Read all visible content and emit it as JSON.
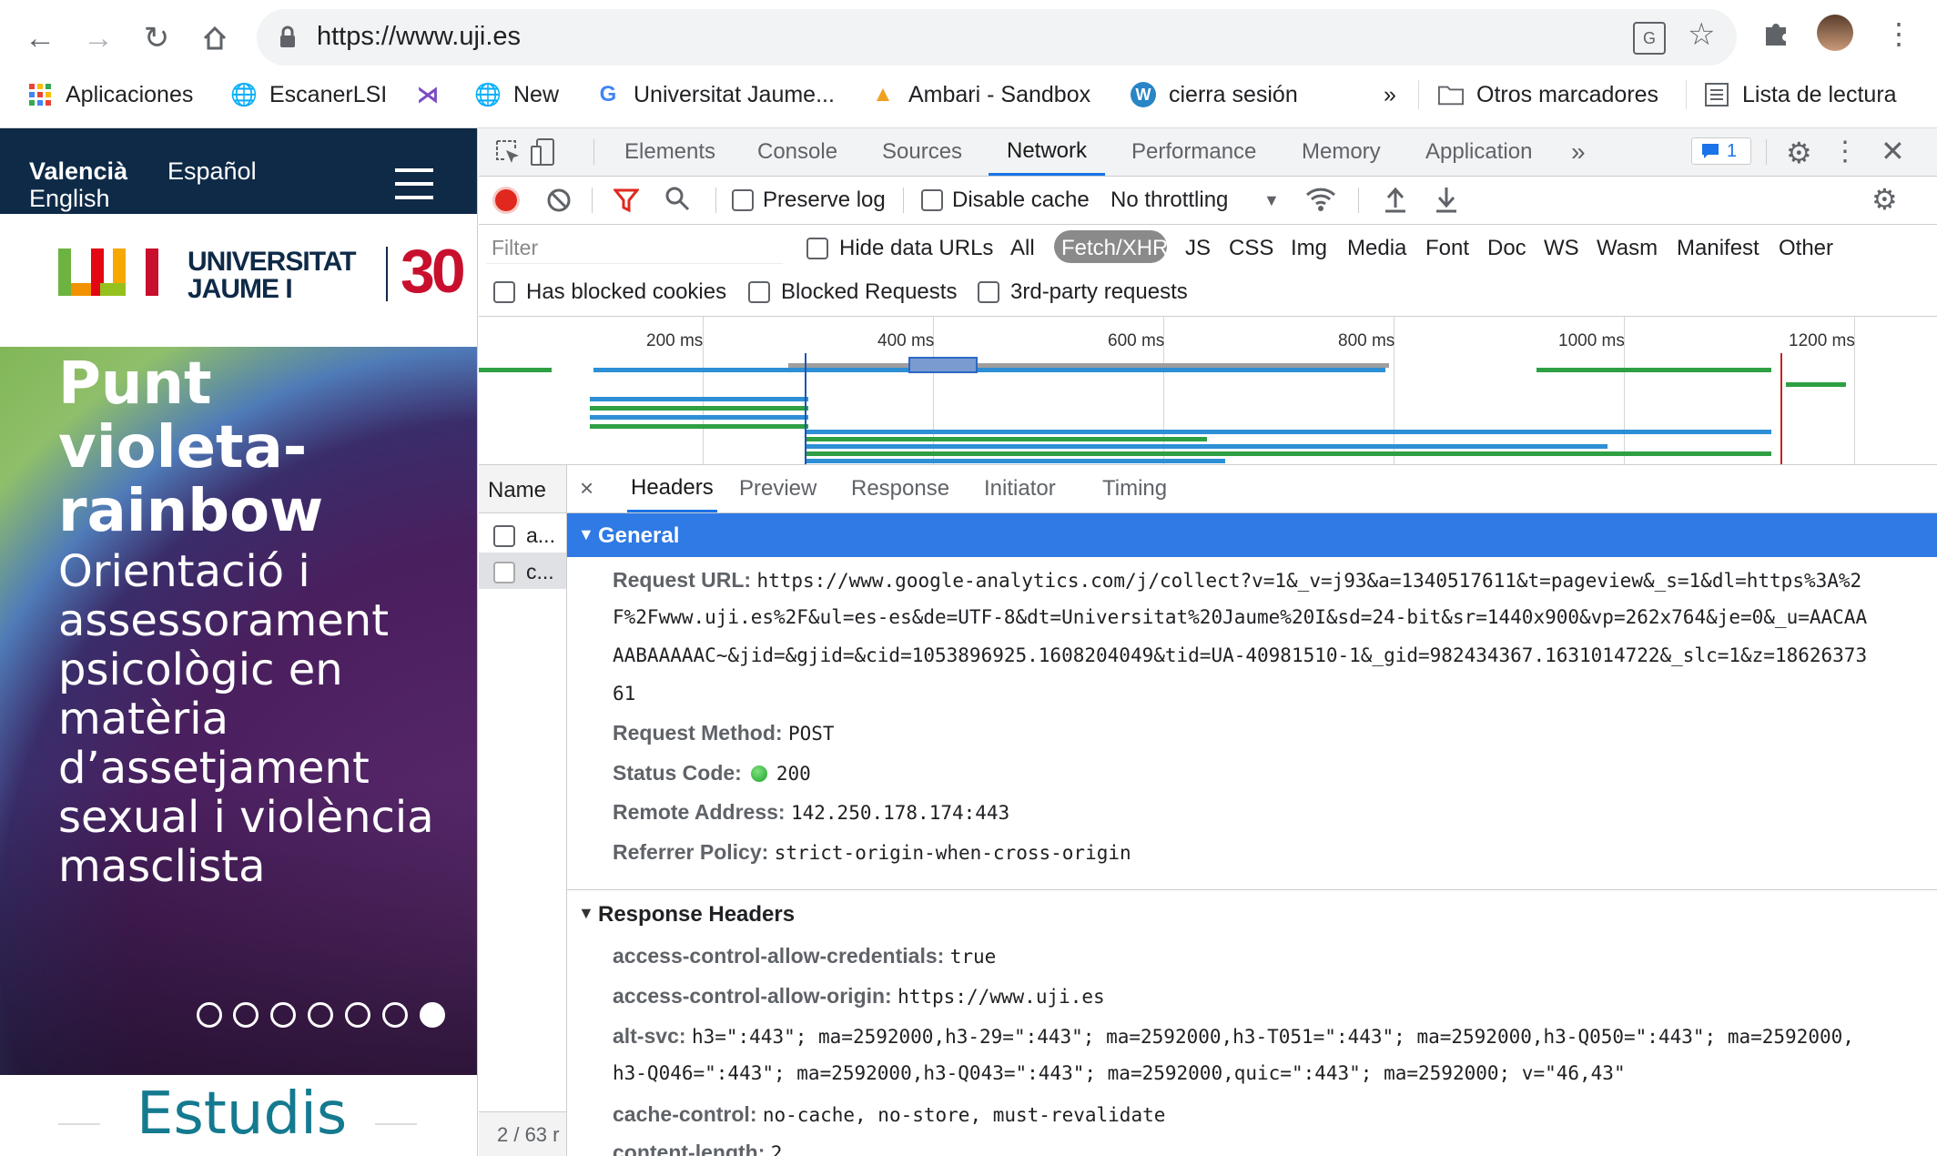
{
  "browser": {
    "url": "https://www.uji.es",
    "bookmarks": [
      {
        "label": "Aplicaciones",
        "icon": "apps-grid-icon"
      },
      {
        "label": "EscanerLSI",
        "icon": "globe-icon"
      },
      {
        "label": "",
        "icon": "kuali-logo-icon"
      },
      {
        "label": "New",
        "icon": "globe-icon"
      },
      {
        "label": "Universitat Jaume...",
        "icon": "google-icon"
      },
      {
        "label": "Ambari - Sandbox",
        "icon": "ambari-icon"
      },
      {
        "label": "cierra sesión",
        "icon": "wordpress-icon"
      }
    ],
    "more_bookmarks": "»",
    "other_bookmarks": "Otros marcadores",
    "reading_list": "Lista de lectura"
  },
  "site": {
    "lang_active": "Valencià",
    "lang_es": "Español",
    "lang_en": "English",
    "logo_text_1": "UNIVERSITAT",
    "logo_text_2": "JAUME I",
    "hero_title": "Punt violeta-rainbow",
    "hero_subtitle": "Orientació i assessorament psicològic en matèria d’assetjament sexual i violència masclista",
    "section_heading": "Estudis"
  },
  "devtools": {
    "tabs": [
      "Elements",
      "Console",
      "Sources",
      "Network",
      "Performance",
      "Memory",
      "Application"
    ],
    "active_tab": "Network",
    "issues_count": "1",
    "toolbar": {
      "preserve_log": "Preserve log",
      "disable_cache": "Disable cache",
      "throttling": "No throttling"
    },
    "filter": {
      "placeholder": "Filter",
      "hide_data_urls": "Hide data URLs",
      "types": [
        "All",
        "Fetch/XHR",
        "JS",
        "CSS",
        "Img",
        "Media",
        "Font",
        "Doc",
        "WS",
        "Wasm",
        "Manifest",
        "Other"
      ],
      "active_type": "Fetch/XHR",
      "has_blocked_cookies": "Has blocked cookies",
      "blocked_requests": "Blocked Requests",
      "third_party": "3rd-party requests"
    },
    "timeline_ticks": [
      "200 ms",
      "400 ms",
      "600 ms",
      "800 ms",
      "1000 ms",
      "1200 ms"
    ],
    "requests": {
      "header": "Name",
      "rows": [
        "a...",
        "c..."
      ],
      "status": "2 / 63 r"
    },
    "detail_tabs": [
      "Headers",
      "Preview",
      "Response",
      "Initiator",
      "Timing"
    ],
    "active_detail_tab": "Headers",
    "general": {
      "title": "General",
      "request_url_key": "Request URL:",
      "request_url_lines": [
        "https://www.google-analytics.com/j/collect?v=1&_v=j93&a=1340517611&t=pageview&_s=1&dl=https%3A%2",
        "F%2Fwww.uji.es%2F&ul=es-es&de=UTF-8&dt=Universitat%20Jaume%20I&sd=24-bit&sr=1440x900&vp=262x764&je=0&_u=AACAA",
        "AABAAAAAC~&jid=&gjid=&cid=1053896925.1608204049&tid=UA-40981510-1&_gid=982434367.1631014722&_slc=1&z=18626373",
        "61"
      ],
      "request_method_key": "Request Method:",
      "request_method": "POST",
      "status_code_key": "Status Code:",
      "status_code": "200",
      "remote_address_key": "Remote Address:",
      "remote_address": "142.250.178.174:443",
      "referrer_policy_key": "Referrer Policy:",
      "referrer_policy": "strict-origin-when-cross-origin"
    },
    "response_headers": {
      "title": "Response Headers",
      "acac_key": "access-control-allow-credentials:",
      "acac": "true",
      "acao_key": "access-control-allow-origin:",
      "acao": "https://www.uji.es",
      "alt_svc_key": "alt-svc:",
      "alt_svc_line1": "h3=\":443\"; ma=2592000,h3-29=\":443\"; ma=2592000,h3-T051=\":443\"; ma=2592000,h3-Q050=\":443\"; ma=2592000,",
      "alt_svc_line2": "h3-Q046=\":443\"; ma=2592000,h3-Q043=\":443\"; ma=2592000,quic=\":443\"; ma=2592000; v=\"46,43\"",
      "cache_control_key": "cache-control:",
      "cache_control": "no-cache, no-store, must-revalidate",
      "content_length_key": "content-length:",
      "content_length": "2"
    },
    "colors": {
      "accent": "#1a73e8",
      "section_bg": "#2f7ae5",
      "record": "#e0281f",
      "ok": "#2db73c"
    }
  }
}
